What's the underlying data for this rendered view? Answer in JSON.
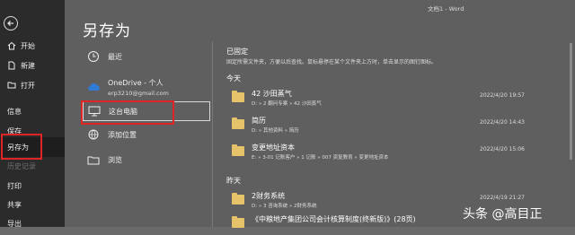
{
  "window": {
    "title": "文档1 - Word"
  },
  "page_title": "另存为",
  "left_nav": {
    "items": [
      {
        "label": "开始",
        "icon": "home-icon"
      },
      {
        "label": "新建",
        "icon": "new-document-icon"
      },
      {
        "label": "打开",
        "icon": "folder-open-icon"
      },
      {
        "label": "信息"
      },
      {
        "label": "保存"
      },
      {
        "label": "另存为"
      },
      {
        "label": "历史记录"
      },
      {
        "label": "打印"
      },
      {
        "label": "共享"
      },
      {
        "label": "导出"
      }
    ]
  },
  "locations": {
    "recent": "最近",
    "onedrive": {
      "label": "OneDrive - 个人",
      "account": "erp3210@gmail.com"
    },
    "this_pc": "这台电脑",
    "add_location": "添加位置",
    "browse": "浏览"
  },
  "pinned": {
    "title": "已固定",
    "desc": "固定所需文件夹，方便以后查找。鼠标悬停在某个文件夹上方时，单击显示的图钉图标。"
  },
  "today": {
    "title": "今天",
    "rows": [
      {
        "name": "42 沙田蒸气",
        "path": "D: » 2 翻问专案 » 42 沙田蒸气",
        "date": "2022/4/20 19:57"
      },
      {
        "name": "简历",
        "path": "D: » 其他资料 » 简历",
        "date": "2022/4/20 14:43"
      },
      {
        "name": "变更地址资本",
        "path": "E: » 3-01 记账客户 » 1 记账 » 007 资复教育 » 变更地址资本",
        "date": "2022/4/20 15:06"
      }
    ]
  },
  "yesterday": {
    "title": "昨天",
    "rows": [
      {
        "name": "2财务系统",
        "path": "D: » 3 咨询系统 » 2财务系统",
        "date": "2022/4/19 21:27"
      },
      {
        "name": "《中粮地产集团公司会计核算制度(终新版)》(28页)",
        "path": "",
        "date": ""
      }
    ]
  },
  "watermark": "头条 @高目正",
  "colors": {
    "highlight": "#e02424",
    "folder": "#e6c36a"
  }
}
